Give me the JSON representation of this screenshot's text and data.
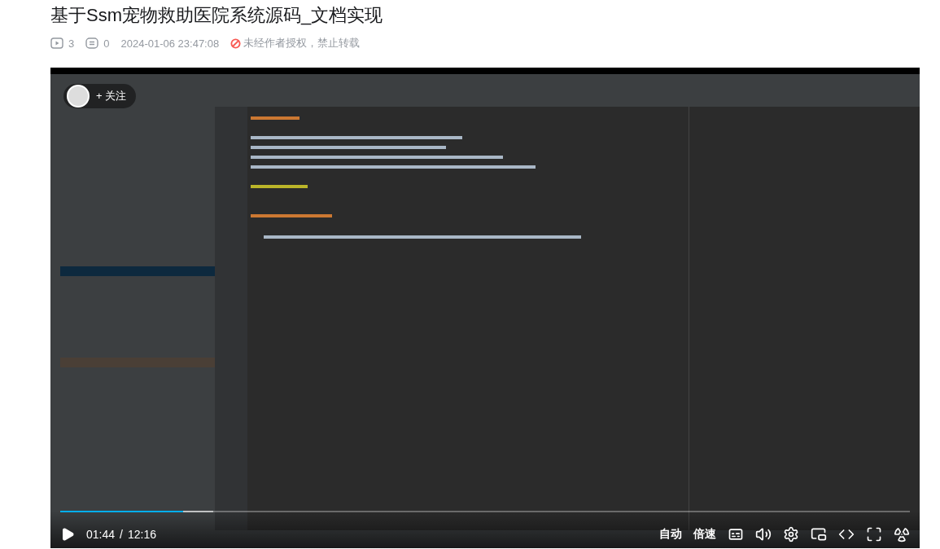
{
  "title": "基于Ssm宠物救助医院系统源码_文档实现",
  "meta": {
    "plays": "3",
    "comments": "0",
    "date": "2024-01-06 23:47:08",
    "notice": "未经作者授权，禁止转载"
  },
  "player": {
    "follow": {
      "label": "+ 关注"
    },
    "progress": {
      "level": 0.145
    },
    "controls": {
      "current": "01:44",
      "separator": "/",
      "duration": "12:16",
      "quality": "自动",
      "speed": "倍速"
    }
  }
}
